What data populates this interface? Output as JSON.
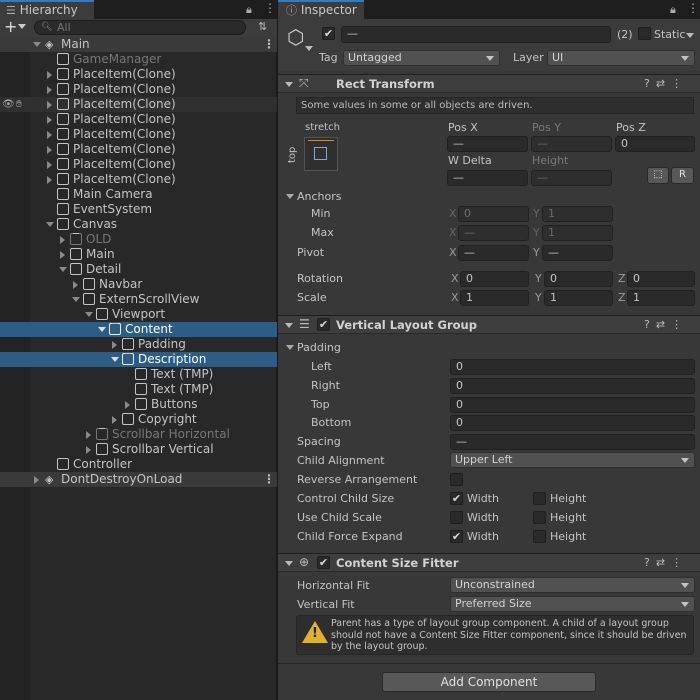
{
  "hierarchy": {
    "tab_label": "Hierarchy",
    "search_placeholder": "All",
    "scene": "Main",
    "items": [
      "GameManager",
      "PlaceItem(Clone)",
      "PlaceItem(Clone)",
      "PlaceItem(Clone)",
      "PlaceItem(Clone)",
      "PlaceItem(Clone)",
      "PlaceItem(Clone)",
      "PlaceItem(Clone)",
      "PlaceItem(Clone)",
      "Main Camera",
      "EventSystem",
      "Canvas",
      "OLD",
      "Main",
      "Detail",
      "Navbar",
      "ExternScrollView",
      "Viewport",
      "Content",
      "Padding",
      "Description",
      "Text (TMP)",
      "Text (TMP)",
      "Buttons",
      "Copyright",
      "Scrollbar Horizontal",
      "Scrollbar Vertical",
      "Controller"
    ],
    "dont_destroy": "DontDestroyOnLoad"
  },
  "inspector": {
    "tab_label": "Inspector",
    "object_name": "—",
    "multi_count": "(2)",
    "static_label": "Static",
    "tag_label": "Tag",
    "tag_value": "Untagged",
    "layer_label": "Layer",
    "layer_value": "UI"
  },
  "rect_transform": {
    "title": "Rect Transform",
    "notice": "Some values in some or all objects are driven.",
    "anchor_preset_h": "stretch",
    "anchor_preset_v": "top",
    "pos_x_label": "Pos X",
    "pos_y_label": "Pos Y",
    "pos_z_label": "Pos Z",
    "pos_x": "—",
    "pos_y": "—",
    "pos_z": "0",
    "w_delta_label": "W Delta",
    "height_label": "Height",
    "w_delta": "—",
    "height": "—",
    "r_button": "R",
    "anchors_label": "Anchors",
    "min_label": "Min",
    "max_label": "Max",
    "min_x": "0",
    "min_y": "1",
    "max_x": "—",
    "max_y": "1",
    "pivot_label": "Pivot",
    "pivot_x": "—",
    "pivot_y": "—",
    "rotation_label": "Rotation",
    "rot_x": "0",
    "rot_y": "0",
    "rot_z": "0",
    "scale_label": "Scale",
    "scale_x": "1",
    "scale_y": "1",
    "scale_z": "1",
    "x": "X",
    "y": "Y",
    "z": "Z"
  },
  "vlg": {
    "title": "Vertical Layout Group",
    "padding_label": "Padding",
    "left_label": "Left",
    "left": "0",
    "right_label": "Right",
    "right": "0",
    "top_label": "Top",
    "top": "0",
    "bottom_label": "Bottom",
    "bottom": "0",
    "spacing_label": "Spacing",
    "spacing": "—",
    "child_alignment_label": "Child Alignment",
    "child_alignment": "Upper Left",
    "reverse_label": "Reverse Arrangement",
    "control_size_label": "Control Child Size",
    "use_scale_label": "Use Child Scale",
    "force_expand_label": "Child Force Expand",
    "width": "Width",
    "height": "Height"
  },
  "csf": {
    "title": "Content Size Fitter",
    "horizontal_label": "Horizontal Fit",
    "horizontal_value": "Unconstrained",
    "vertical_label": "Vertical Fit",
    "vertical_value": "Preferred Size",
    "warning": "Parent has a type of layout group component. A child of a layout group should not have a Content Size Fitter component, since it should be driven by the layout group."
  },
  "add_component": "Add Component"
}
